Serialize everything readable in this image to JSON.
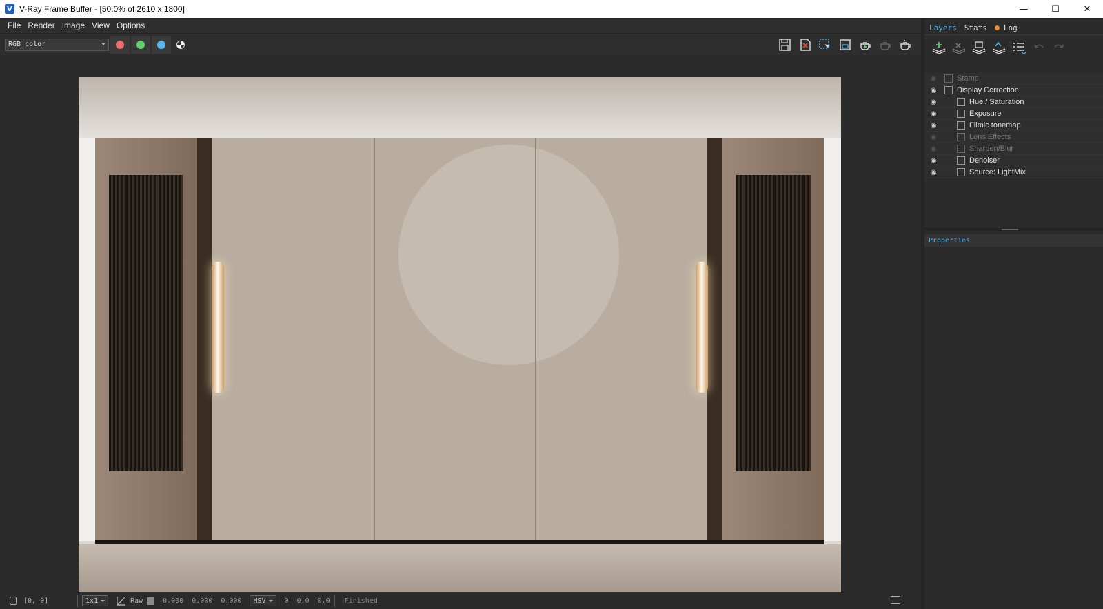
{
  "window": {
    "app_icon_glyph": "V",
    "title": "V-Ray Frame Buffer - [50.0% of 2610 x 1800]",
    "minimize_glyph": "—",
    "maximize_glyph": "☐",
    "close_glyph": "✕"
  },
  "menu": {
    "file": "File",
    "render": "Render",
    "image": "Image",
    "view": "View",
    "options": "Options"
  },
  "toolbar": {
    "channel_value": "RGB color",
    "colors": {
      "red": "#ef6b6b",
      "green": "#5fd06a",
      "blue": "#5ab7ef"
    }
  },
  "status": {
    "coords": "[0, 0]",
    "zoom": "1x1",
    "raw": "Raw",
    "v1": "0.000",
    "v2": "0.000",
    "v3": "0.000",
    "color_mode": "HSV",
    "h": "0",
    "s": "0.0",
    "v": "0.0",
    "message": "Finished"
  },
  "tabs": {
    "layers": "Layers",
    "stats": "Stats",
    "log": "Log"
  },
  "layers": [
    {
      "name": "Stamp",
      "enabled": false,
      "child": false
    },
    {
      "name": "Display Correction",
      "enabled": true,
      "child": false
    },
    {
      "name": "Hue / Saturation",
      "enabled": true,
      "child": true
    },
    {
      "name": "Exposure",
      "enabled": true,
      "child": true
    },
    {
      "name": "Filmic tonemap",
      "enabled": true,
      "child": true
    },
    {
      "name": "Lens Effects",
      "enabled": false,
      "child": true
    },
    {
      "name": "Sharpen/Blur",
      "enabled": false,
      "child": true
    },
    {
      "name": "Denoiser",
      "enabled": true,
      "child": true
    },
    {
      "name": "Source: LightMix",
      "enabled": true,
      "child": true
    }
  ],
  "properties": {
    "header": "Properties"
  },
  "icons": {
    "save": "save-icon",
    "clear": "clear-image-icon",
    "region": "region-render-icon",
    "track_mouse": "track-mouse-icon",
    "render": "render-teapot-icon",
    "stop": "stop-render-icon",
    "interactive": "interactive-render-icon"
  }
}
